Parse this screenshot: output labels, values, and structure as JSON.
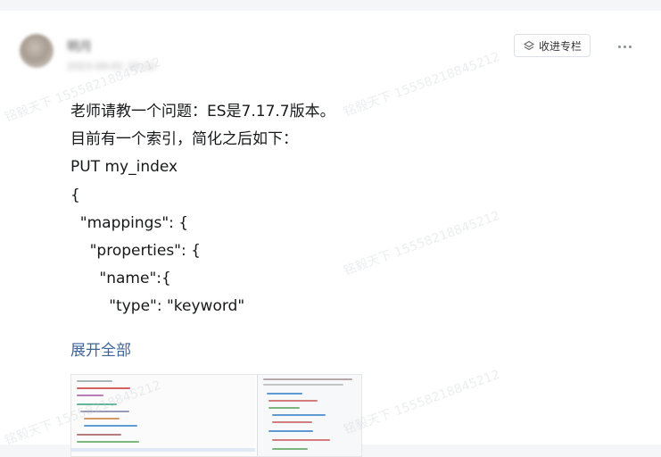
{
  "post": {
    "author_name": "明月",
    "author_meta": "2023-04-01 10:12",
    "follow_label": "收进专栏",
    "content_lines": [
      "老师请教一个问题：ES是7.17.7版本。",
      "目前有一个索引，简化之后如下：",
      "PUT my_index",
      "{",
      "  \"mappings\": {",
      "    \"properties\": {",
      "      \"name\":{",
      "        \"type\": \"keyword\""
    ],
    "expand_label": "展开全部"
  },
  "watermark_text": "铭毅天下 15558218845212",
  "icons": {
    "follow": "bookmark-stack-icon",
    "more": "more-horizontal-icon"
  },
  "colors": {
    "link": "#406599",
    "text": "#17181a",
    "background": "#f5f6f7"
  }
}
